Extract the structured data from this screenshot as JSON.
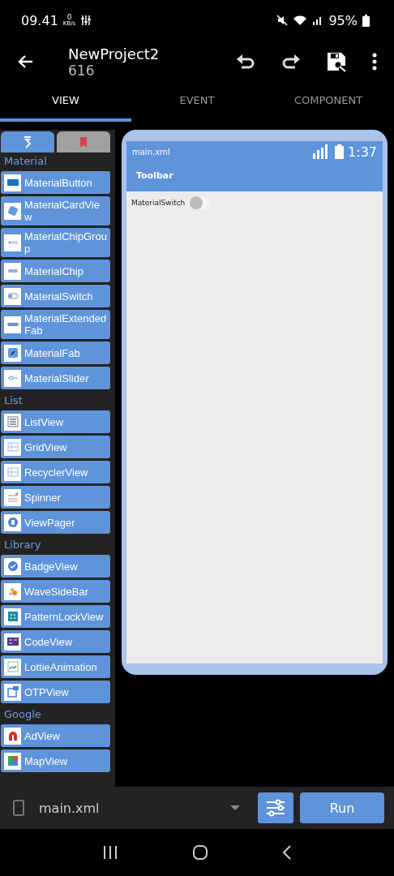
{
  "status_bar": {
    "time": "09.41",
    "net_speed": "0",
    "net_unit": "KB/s",
    "battery": "95%"
  },
  "app_bar": {
    "title": "NewProject2",
    "subtitle": "616"
  },
  "tabs": [
    {
      "label": "VIEW",
      "selected": true
    },
    {
      "label": "EVENT",
      "selected": false
    },
    {
      "label": "COMPONENT",
      "selected": false
    }
  ],
  "palette_tabs": [
    {
      "selected": true
    },
    {
      "selected": false
    }
  ],
  "palette": [
    {
      "title": "Material",
      "items": [
        "MaterialButton",
        "MaterialCardView",
        "MaterialChipGroup",
        "MaterialChip",
        "MaterialSwitch",
        "MaterialExtendedFab",
        "MaterialFab",
        "MaterialSlider"
      ]
    },
    {
      "title": "List",
      "items": [
        "ListView",
        "GridView",
        "RecyclerView",
        "Spinner",
        "ViewPager"
      ]
    },
    {
      "title": "Library",
      "items": [
        "BadgeView",
        "WaveSideBar",
        "PatternLockView",
        "CodeView",
        "LottieAnimation",
        "OTPView"
      ]
    },
    {
      "title": "Google",
      "items": [
        "AdView",
        "MapView"
      ]
    }
  ],
  "preview": {
    "file": "main.xml",
    "time": "1:37",
    "toolbar": "Toolbar",
    "widget": {
      "label": "MaterialSwitch",
      "checked": false
    }
  },
  "bottom_bar": {
    "file": "main.xml",
    "run": "Run"
  }
}
